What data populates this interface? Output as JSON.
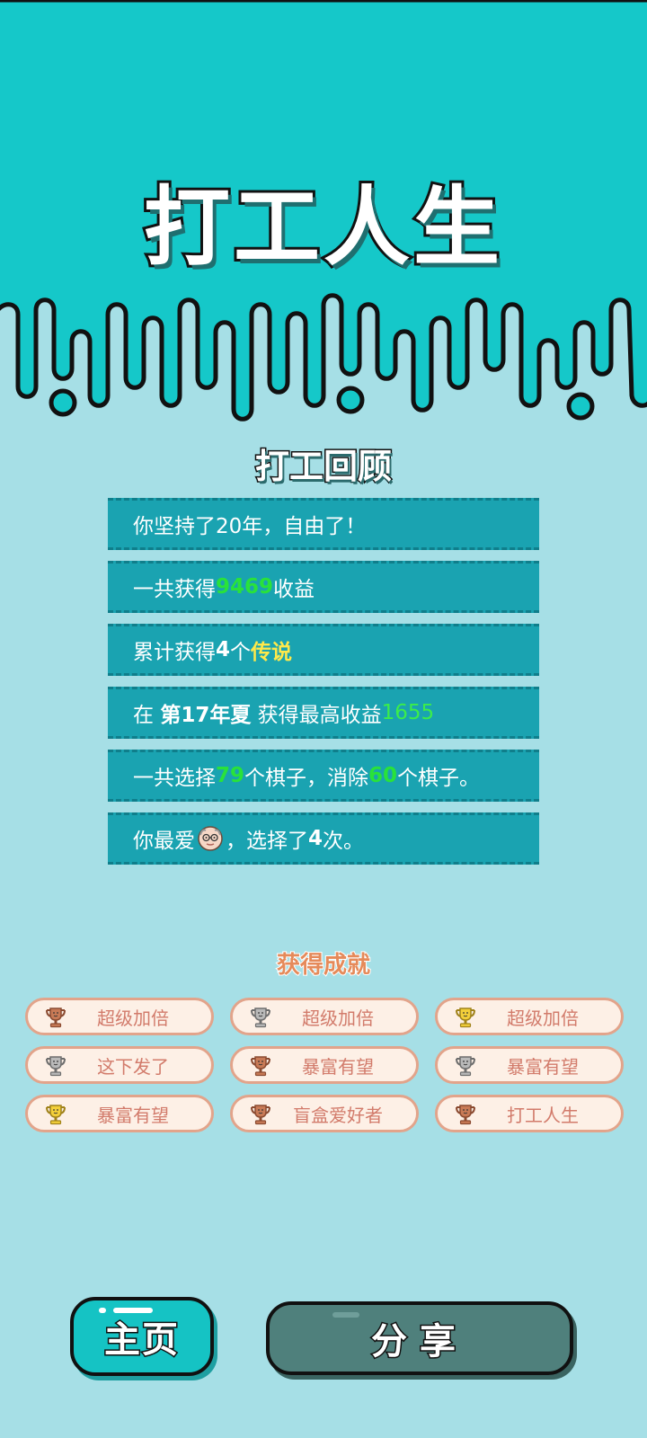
{
  "app": {
    "title": "打工人生"
  },
  "colors": {
    "top_band": "#15c8c9",
    "background": "#a6dfe6",
    "row_bg": "#1aa3b1",
    "highlight_green": "#29e23a",
    "highlight_yellow": "#ffe94a",
    "achievement_text": "#d27b6b",
    "home_button": "#15c3c4",
    "share_button": "#4f807c"
  },
  "review": {
    "title": "打工回顾",
    "rows": [
      {
        "text": "你坚持了20年，自由了！"
      },
      {
        "pre": "一共获得",
        "value": "9469",
        "post": "收益"
      },
      {
        "pre": "累计获得",
        "count": "4",
        "mid": "个",
        "tag": "传说"
      },
      {
        "pre": "在 ",
        "season": "第17年夏",
        "mid": " 获得最高收益",
        "value": "1655"
      },
      {
        "pre": "一共选择",
        "chosen": "79",
        "mid": "个棋子，消除",
        "removed": "60",
        "post": "个棋子。"
      },
      {
        "pre": "你最爱",
        "icon": "old-man-face-icon",
        "mid": "，选择了",
        "times": "4",
        "post": "次。"
      }
    ]
  },
  "achievements": {
    "title": "获得成就",
    "items": [
      {
        "label": "超级加倍",
        "trophy": "bronze"
      },
      {
        "label": "超级加倍",
        "trophy": "silver"
      },
      {
        "label": "超级加倍",
        "trophy": "gold"
      },
      {
        "label": "这下发了",
        "trophy": "silver"
      },
      {
        "label": "暴富有望",
        "trophy": "bronze"
      },
      {
        "label": "暴富有望",
        "trophy": "silver"
      },
      {
        "label": "暴富有望",
        "trophy": "gold"
      },
      {
        "label": "盲盒爱好者",
        "trophy": "bronze"
      },
      {
        "label": "打工人生",
        "trophy": "bronze"
      }
    ]
  },
  "buttons": {
    "home_label": "主页",
    "share_label": "分享"
  }
}
